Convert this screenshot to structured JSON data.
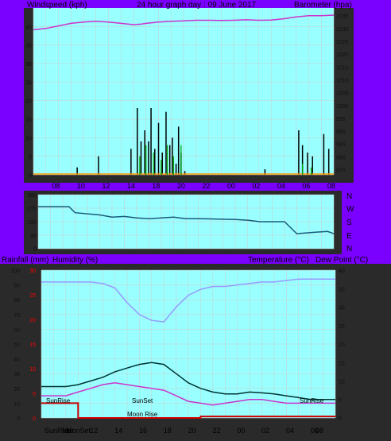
{
  "titles": {
    "windspeed": "Windspeed (kph)",
    "main": "24 hour graph day : 09 June 2017",
    "barometer": "Barometer (hpa)",
    "rainfall": "Rainfall (mm)",
    "humidity": "Humidity (%)",
    "temperature": "Temperature (°C)",
    "dewpoint": "Dew Point (°C)"
  },
  "directions": [
    "N",
    "W",
    "S",
    "E",
    "N"
  ],
  "annotations": {
    "sunrise1": "SunRise",
    "sunset": "SunSet",
    "moonrise": "Moon Rise",
    "sunrise2": "SunRise"
  },
  "bottom_axis_extra": [
    "SunRise",
    "MoonSet"
  ],
  "colors": {
    "background": "#7a00ff",
    "plot": "#99ffff",
    "barometer": "#cc33cc",
    "wind": "#000000",
    "gust": "#00aa00",
    "direction": "#1a5a7a",
    "humidity": "#9999ff",
    "temperature": "#003333",
    "dewpoint": "#cc33cc",
    "rain": "#cc0000"
  },
  "chart_data": [
    {
      "type": "line",
      "name": "wind-barometer",
      "x_tick_labels": [
        "08",
        "10",
        "12",
        "14",
        "18",
        "20",
        "22",
        "00",
        "02",
        "04",
        "06",
        "08"
      ],
      "left_ticks": [
        "0",
        "5",
        "10",
        "15",
        "20",
        "25",
        "30",
        "35",
        "40"
      ],
      "right_ticks": [
        "975",
        "980",
        "985",
        "990",
        "995",
        "1000",
        "1005",
        "1010",
        "1015",
        "1020",
        "1025",
        "1030",
        "1035"
      ],
      "ylim_left": [
        0,
        45
      ],
      "ylim_right": [
        973,
        1038
      ],
      "barometer": [
        [
          0,
          1029.5
        ],
        [
          1,
          1030
        ],
        [
          2,
          1031
        ],
        [
          3,
          1032
        ],
        [
          4,
          1032.5
        ],
        [
          5,
          1032.8
        ],
        [
          6,
          1032.5
        ],
        [
          7,
          1032
        ],
        [
          8,
          1031.5
        ],
        [
          8.6,
          1031.7
        ],
        [
          9,
          1032
        ],
        [
          10,
          1032.5
        ],
        [
          11,
          1032.8
        ],
        [
          12,
          1033
        ],
        [
          13,
          1033.2
        ],
        [
          14,
          1033.2
        ],
        [
          15,
          1033.1
        ],
        [
          16,
          1033.2
        ],
        [
          17,
          1033.4
        ],
        [
          18,
          1033.2
        ],
        [
          19,
          1033.3
        ],
        [
          20,
          1033.8
        ],
        [
          21,
          1034.5
        ],
        [
          22,
          1035
        ],
        [
          23,
          1035
        ],
        [
          24,
          1035.2
        ]
      ],
      "wind": [
        [
          3.5,
          2
        ],
        [
          5.2,
          5
        ],
        [
          7.8,
          7
        ],
        [
          8.3,
          18
        ],
        [
          8.6,
          9
        ],
        [
          8.9,
          12
        ],
        [
          9.2,
          9
        ],
        [
          9.4,
          18
        ],
        [
          9.7,
          7
        ],
        [
          10,
          14
        ],
        [
          10.3,
          6
        ],
        [
          10.6,
          17
        ],
        [
          10.9,
          8
        ],
        [
          11.1,
          10
        ],
        [
          11.4,
          3
        ],
        [
          11.6,
          13
        ],
        [
          11.8,
          6
        ],
        [
          12.1,
          1
        ],
        [
          18.5,
          1.5
        ],
        [
          21.2,
          12
        ],
        [
          21.5,
          8
        ],
        [
          21.9,
          6
        ],
        [
          22.3,
          5
        ],
        [
          23.2,
          11
        ],
        [
          23.6,
          7
        ]
      ],
      "gust": [
        [
          8.5,
          5
        ],
        [
          9,
          8
        ],
        [
          9.6,
          6
        ],
        [
          10.2,
          4
        ],
        [
          10.7,
          8
        ],
        [
          11.2,
          5
        ],
        [
          11.8,
          8
        ],
        [
          21.5,
          3
        ],
        [
          22.2,
          2
        ]
      ]
    },
    {
      "type": "line",
      "name": "wind-direction",
      "x_tick_labels": [],
      "left_ticks": [
        "360",
        "270",
        "180",
        "90",
        "0"
      ],
      "ylim": [
        0,
        360
      ],
      "values": [
        [
          0,
          280
        ],
        [
          2.5,
          280
        ],
        [
          3,
          240
        ],
        [
          5,
          225
        ],
        [
          6,
          210
        ],
        [
          7,
          215
        ],
        [
          8,
          205
        ],
        [
          9,
          200
        ],
        [
          10,
          205
        ],
        [
          11,
          210
        ],
        [
          12,
          200
        ],
        [
          13,
          200
        ],
        [
          16,
          195
        ],
        [
          17,
          190
        ],
        [
          18,
          180
        ],
        [
          19,
          180
        ],
        [
          20,
          180
        ],
        [
          21,
          100
        ],
        [
          22.5,
          110
        ],
        [
          23.5,
          115
        ],
        [
          24,
          100
        ]
      ]
    },
    {
      "type": "line",
      "name": "rain-humidity-temp",
      "x_tick_labels": [
        "SunRise",
        "MoonSet",
        "10",
        "12",
        "14",
        "16",
        "18",
        "20",
        "22",
        "00",
        "02",
        "04",
        "06",
        "08"
      ],
      "left_ticks_humidity": [
        "0",
        "10",
        "20",
        "30",
        "40",
        "50",
        "60",
        "70",
        "80",
        "90",
        "100"
      ],
      "left_ticks_rain": [
        "0",
        "5",
        "10",
        "15",
        "20",
        "25",
        "30"
      ],
      "right_ticks": [
        "0",
        "5",
        "10",
        "15",
        "20",
        "25",
        "30",
        "35",
        "40"
      ],
      "humidity": [
        [
          0,
          92
        ],
        [
          4,
          92
        ],
        [
          5,
          91
        ],
        [
          6,
          88
        ],
        [
          7,
          78
        ],
        [
          8,
          70
        ],
        [
          9,
          66
        ],
        [
          10,
          65
        ],
        [
          11,
          75
        ],
        [
          12,
          83
        ],
        [
          13,
          87
        ],
        [
          14,
          89
        ],
        [
          15,
          89
        ],
        [
          16,
          90
        ],
        [
          17,
          91
        ],
        [
          18,
          92
        ],
        [
          19,
          92
        ],
        [
          20,
          93
        ],
        [
          21,
          94
        ],
        [
          22,
          94
        ],
        [
          23,
          94
        ],
        [
          24,
          94
        ]
      ],
      "temperature": [
        [
          0,
          8.5
        ],
        [
          2,
          8.5
        ],
        [
          3,
          9
        ],
        [
          4,
          10
        ],
        [
          5,
          11
        ],
        [
          6,
          12.5
        ],
        [
          7,
          13.5
        ],
        [
          8,
          14.5
        ],
        [
          9,
          15
        ],
        [
          10,
          14.5
        ],
        [
          11,
          12
        ],
        [
          12,
          9.5
        ],
        [
          13,
          8
        ],
        [
          14,
          7
        ],
        [
          15,
          6.5
        ],
        [
          16,
          6.5
        ],
        [
          17,
          7
        ],
        [
          18,
          6.8
        ],
        [
          19,
          6.5
        ],
        [
          20,
          6
        ],
        [
          21,
          5.5
        ],
        [
          22,
          5
        ],
        [
          23,
          5
        ],
        [
          24,
          5
        ]
      ],
      "dewpoint": [
        [
          0,
          6
        ],
        [
          2,
          6
        ],
        [
          3,
          7
        ],
        [
          4,
          8
        ],
        [
          5,
          9
        ],
        [
          6,
          9.5
        ],
        [
          7,
          9
        ],
        [
          8,
          8.5
        ],
        [
          9,
          8
        ],
        [
          10,
          7.5
        ],
        [
          11,
          6
        ],
        [
          12,
          4.5
        ],
        [
          13,
          4
        ],
        [
          14,
          3.5
        ],
        [
          15,
          4
        ],
        [
          16,
          4.5
        ],
        [
          17,
          5
        ],
        [
          18,
          5
        ],
        [
          19,
          4.5
        ],
        [
          20,
          4
        ],
        [
          21,
          4
        ],
        [
          22,
          4
        ],
        [
          23,
          4
        ],
        [
          24,
          4
        ]
      ],
      "rain": [
        [
          0,
          3
        ],
        [
          3,
          3
        ],
        [
          3,
          0
        ],
        [
          13,
          0
        ],
        [
          13,
          0.3
        ],
        [
          24,
          0.3
        ]
      ]
    }
  ]
}
